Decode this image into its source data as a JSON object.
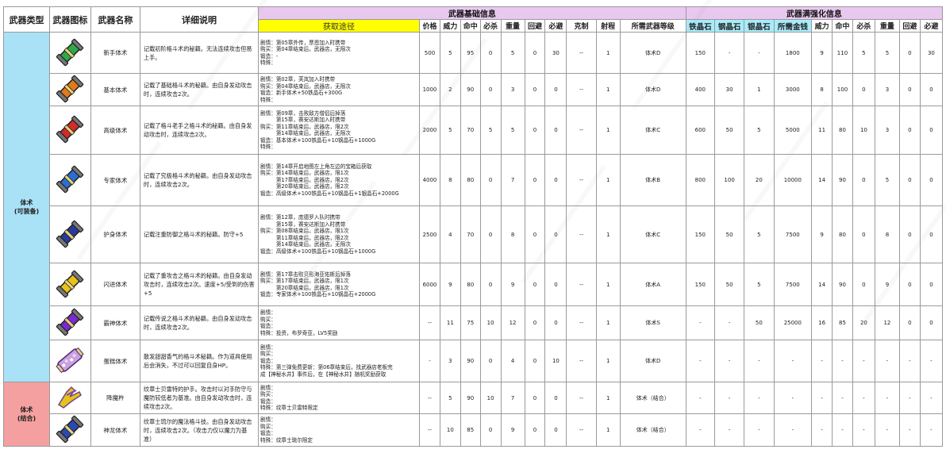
{
  "headers": {
    "type": "武器类型",
    "icon": "武器图标",
    "name": "武器名称",
    "desc": "详细说明",
    "basic_group": "武器基础信息",
    "enh_group": "武器满强化信息",
    "route": "获取途径",
    "basic_cols": [
      "价格",
      "威力",
      "命中",
      "必杀",
      "重量",
      "回避",
      "必避",
      "克制",
      "射程",
      "所需武器等级"
    ],
    "enh_cols": [
      "铁晶石",
      "钢晶石",
      "银晶石",
      "所需金钱",
      "威力",
      "命中",
      "必杀",
      "重量",
      "回避",
      "必避"
    ]
  },
  "categories": [
    {
      "label": "体术\n(可装备)",
      "color": "#a9e1f7"
    },
    {
      "label": "体术\n(结合)",
      "color": "#f4a0a0"
    }
  ],
  "rows": [
    {
      "cat": 0,
      "icon": "green-scroll-icon",
      "color": "#2fa84a",
      "name": "新手体术",
      "desc": "记载初阶格斗术的秘籍。无法连续攻击但易上手。",
      "route": [
        "剧情：第05章外传，票恩加入时携带",
        "购买：第04章结束后，武器店，无限次",
        "锻造：-",
        "特殊："
      ],
      "basic": [
        "500",
        "5",
        "95",
        "0",
        "5",
        "0",
        "30",
        "--",
        "1",
        "体术D"
      ],
      "enh": [
        "150",
        "-",
        "-",
        "1800",
        "9",
        "110",
        "5",
        "5",
        "0",
        "30"
      ]
    },
    {
      "cat": 0,
      "icon": "orange-scroll-icon",
      "color": "#e07a1c",
      "name": "基本体术",
      "desc": "记载了基础格斗术的秘籍。由自身发动攻击时，连续攻击2次。",
      "route": [
        "剧情：第02章，芙岚加入时携带",
        "购买：第04章结束后，武器店，无限次",
        "锻造：新手体术+50铁晶石+300G",
        "特殊："
      ],
      "basic": [
        "1000",
        "2",
        "90",
        "0",
        "3",
        "0",
        "0",
        "--",
        "1",
        "体术D"
      ],
      "enh": [
        "400",
        "30",
        "1",
        "3000",
        "8",
        "100",
        "0",
        "3",
        "0",
        "0"
      ]
    },
    {
      "cat": 0,
      "icon": "red-scroll-icon",
      "color": "#d42a2a",
      "name": "高级体术",
      "desc": "记载了格斗老手之格斗术的秘籍。由自身发动攻击时，连续攻击2次。",
      "route": [
        "剧情：第09章，击败敌方僧侣后掉落",
        "　　　第15章，赛安达斯加入时携带",
        "购买：第11章结束后，武器店，限2次",
        "　　　第14章结束后，武器店，无限次",
        "锻造：基本体术+100铁晶石+10钢晶石+1000G",
        "特殊："
      ],
      "basic": [
        "2000",
        "5",
        "70",
        "5",
        "5",
        "0",
        "0",
        "--",
        "1",
        "体术C"
      ],
      "enh": [
        "600",
        "50",
        "5",
        "5000",
        "11",
        "80",
        "10",
        "3",
        "0",
        "0"
      ]
    },
    {
      "cat": 0,
      "icon": "blue-scroll-icon",
      "color": "#2a6fd0",
      "name": "专家体术",
      "desc": "记载了究极格斗术的秘籍。由自身发动攻击时，连续攻击2次。",
      "route": [
        "剧情：第14章开启地图左上角左边的宝箱后获取",
        "购买：第14章结束后，武器店，限1次",
        "　　　第17章结束后，武器店，限2次",
        "　　　第20章结束后，武器店，限2次",
        "锻造：高级体术+100铁晶石+10钢晶石+1银晶石+2000G"
      ],
      "basic": [
        "4000",
        "8",
        "80",
        "0",
        "7",
        "0",
        "0",
        "--",
        "1",
        "体术B"
      ],
      "enh": [
        "800",
        "100",
        "20",
        "10000",
        "14",
        "90",
        "0",
        "5",
        "0",
        "0"
      ]
    },
    {
      "cat": 0,
      "icon": "navy-scroll-icon",
      "color": "#2a3a9a",
      "name": "护身体术",
      "desc": "记载注重防御之格斗术的秘籍。防守+5",
      "route": [
        "剧情：第12章，庞德罗入队时携带",
        "　　　第15章，赛安达斯加入时携带",
        "购买：第08章结束后，武器店，限1次",
        "　　　第11章结束后，武器店，限2次",
        "　　　第14章结束后，武器店，无限次",
        "锻造：高级体术+100铁晶石+10钢晶石+1000G"
      ],
      "basic": [
        "2500",
        "4",
        "70",
        "0",
        "8",
        "0",
        "0",
        "--",
        "1",
        "体术C"
      ],
      "enh": [
        "150",
        "50",
        "5",
        "7500",
        "9",
        "80",
        "0",
        "8",
        "0",
        "0"
      ]
    },
    {
      "cat": 0,
      "icon": "yellow-scroll-icon",
      "color": "#e8c21a",
      "name": "闪进体术",
      "desc": "记载了重攻击之格斗术的秘籍。由自身发动攻击时，连续攻击2次。速度+5/受到的伤害+5",
      "route": [
        "剧情：第17章击败贝形海亚佑斯后掉落",
        "购买：第17章结束后，武器店，限1次",
        "　　　第20章结束后，武器店，限1次",
        "锻造：专家体术+100铁晶石+10钢晶石+2000G"
      ],
      "basic": [
        "6000",
        "9",
        "80",
        "0",
        "9",
        "0",
        "0",
        "--",
        "1",
        "体术A"
      ],
      "enh": [
        "150",
        "50",
        "5",
        "7500",
        "14",
        "90",
        "0",
        "9",
        "0",
        "0"
      ]
    },
    {
      "cat": 0,
      "icon": "purple-scroll-icon",
      "color": "#7a2ad0",
      "name": "霸神体术",
      "desc": "记载传说之格斗术的秘籍。由自身发动攻击时，连续攻击2次。",
      "route": [
        "剧情：",
        "购买：",
        "锻造：",
        "特殊：投资，布罗奇亚，LV5奖励"
      ],
      "basic": [
        "--",
        "11",
        "75",
        "10",
        "12",
        "0",
        "0",
        "--",
        "1",
        "体术S"
      ],
      "enh": [
        "-",
        "-",
        "50",
        "25000",
        "16",
        "85",
        "20",
        "12",
        "0",
        "0"
      ]
    },
    {
      "cat": 0,
      "icon": "candy-scroll-icon",
      "color": "#9a6ab8",
      "name": "蛋糕体术",
      "desc": "散发甜甜香气的格斗术秘籍。作为道具使用后会消失，不过可以回复自身HP。",
      "route": [
        "剧情：",
        "购买：",
        "锻造：",
        "特殊：第三弹免费更新：第06章结束后，找武器店老板完",
        "成【神秘水井】事件后，在【神秘水井】随机奖励获取"
      ],
      "basic": [
        "-",
        "3",
        "90",
        "0",
        "4",
        "0",
        "10",
        "--",
        "1",
        "体术D"
      ],
      "enh": [
        "-",
        "-",
        "-",
        "-",
        "-",
        "-",
        "-",
        "-",
        "-",
        "-"
      ]
    },
    {
      "cat": 1,
      "icon": "gauntlet-icon",
      "color": "#e6c21a",
      "name": "降魔杵",
      "desc": "纹章士贝雷特的护手。攻击时以对手防守与魔防较低者为基准。由自身发动攻击时，连续攻击2次。",
      "route": [
        "剧情：",
        "购买：",
        "锻造：",
        "特殊：纹章士贝雷特限定"
      ],
      "basic": [
        "--",
        "5",
        "90",
        "10",
        "7",
        "0",
        "0",
        "--",
        "1",
        "体术（结合）"
      ],
      "enh": [
        "-",
        "-",
        "-",
        "-",
        "-",
        "-",
        "-",
        "-",
        "-",
        "-"
      ]
    },
    {
      "cat": 1,
      "icon": "dragon-scroll-icon",
      "color": "#2a4ab0",
      "name": "神龙体术",
      "desc": "纹章士琉尔的魔法格斗技。由自身发动攻击时，连续攻击2次。（攻击力仅以魔力为基准）",
      "route": [
        "剧情：",
        "购买：",
        "锻造：",
        "特殊：纹章士琉尔限定"
      ],
      "basic": [
        "--",
        "10",
        "85",
        "0",
        "9",
        "0",
        "0",
        "--",
        "1",
        "体术（结合）"
      ],
      "enh": [
        "-",
        "-",
        "-",
        "-",
        "-",
        "-",
        "-",
        "-",
        "-",
        "-"
      ]
    }
  ]
}
